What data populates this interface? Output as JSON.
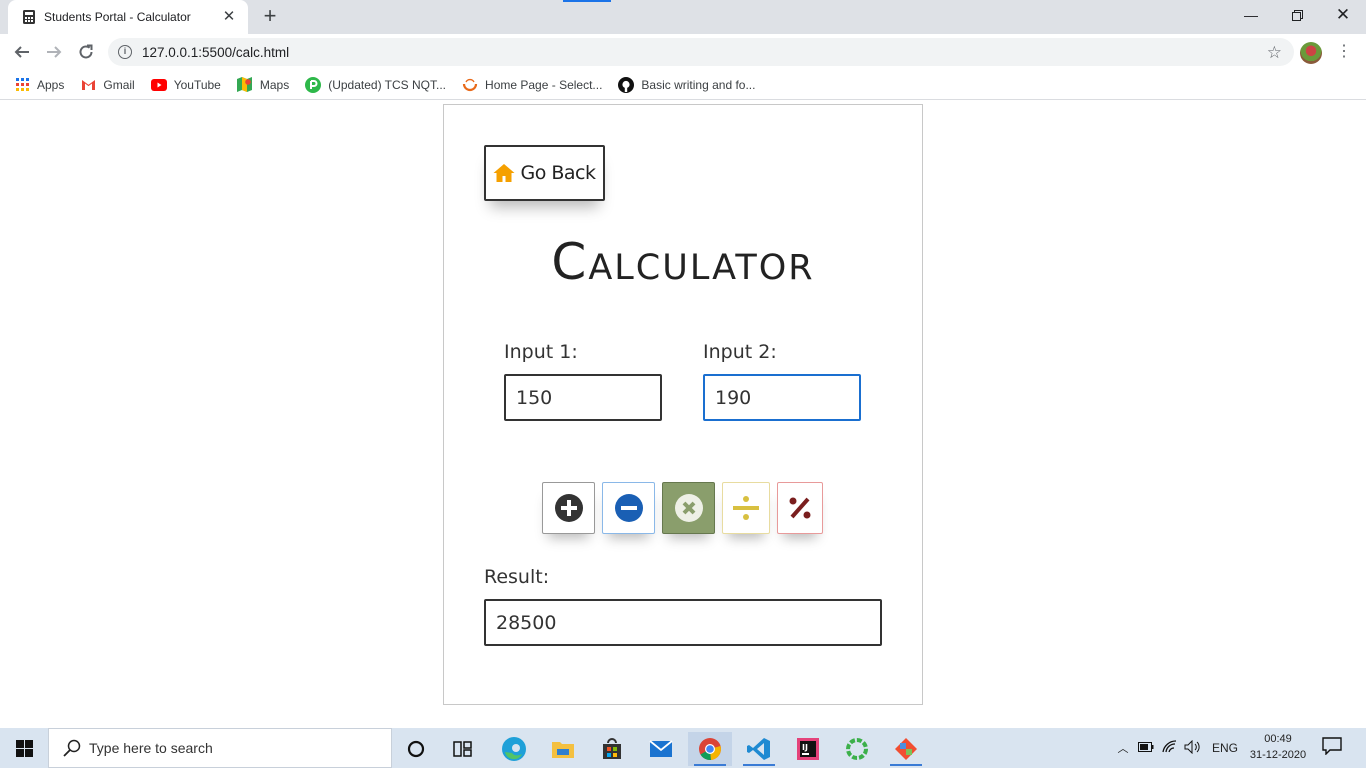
{
  "browser": {
    "tab_title": "Students Portal - Calculator",
    "url": "127.0.0.1:5500/calc.html",
    "bookmarks": [
      {
        "label": "Apps",
        "icon": "apps-grid-icon"
      },
      {
        "label": "Gmail",
        "icon": "gmail-icon"
      },
      {
        "label": "YouTube",
        "icon": "youtube-icon"
      },
      {
        "label": "Maps",
        "icon": "maps-icon"
      },
      {
        "label": "(Updated) TCS NQT...",
        "icon": "tcs-icon"
      },
      {
        "label": "Home Page - Select...",
        "icon": "home-page-icon"
      },
      {
        "label": "Basic writing and fo...",
        "icon": "github-icon"
      }
    ]
  },
  "page": {
    "go_back_label": "Go Back",
    "title": "Calculator",
    "input1_label": "Input 1:",
    "input1_value": "150",
    "input2_label": "Input 2:",
    "input2_value": "190",
    "operations": [
      {
        "name": "add",
        "icon": "plus-circle-icon"
      },
      {
        "name": "subtract",
        "icon": "minus-circle-icon"
      },
      {
        "name": "multiply",
        "icon": "times-circle-icon"
      },
      {
        "name": "divide",
        "icon": "divide-icon"
      },
      {
        "name": "modulo",
        "icon": "percent-icon"
      }
    ],
    "result_label": "Result:",
    "result_value": "28500"
  },
  "taskbar": {
    "search_placeholder": "Type here to search",
    "language": "ENG",
    "time": "00:49",
    "date": "31-12-2020"
  },
  "colors": {
    "home_icon": "#f5a000",
    "focus_border": "#1a6fd0",
    "multiply_bg": "#8a9e6c",
    "divide_icon": "#d8c040",
    "percent_icon": "#7a1e1e",
    "minus_icon": "#1a5fb4"
  }
}
